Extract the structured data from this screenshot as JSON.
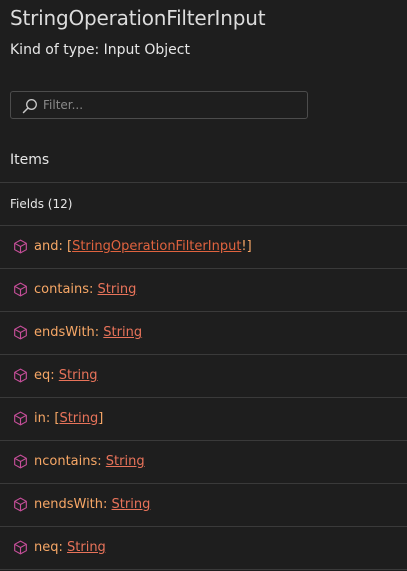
{
  "header": {
    "title": "StringOperationFilterInput",
    "kind": "Kind of type: Input Object"
  },
  "filter": {
    "placeholder": "Filter...",
    "icon": "search-icon"
  },
  "items": {
    "label": "Items"
  },
  "fields": {
    "label": "Fields (12)",
    "icon": "cube-icon",
    "rows": [
      {
        "name": "and",
        "prefix": ": [",
        "type": "StringOperationFilterInput",
        "suffix": "!]"
      },
      {
        "name": "contains",
        "prefix": ": ",
        "type": "String",
        "suffix": ""
      },
      {
        "name": "endsWith",
        "prefix": ": ",
        "type": "String",
        "suffix": ""
      },
      {
        "name": "eq",
        "prefix": ": ",
        "type": "String",
        "suffix": ""
      },
      {
        "name": "in",
        "prefix": ": [",
        "type": "String",
        "suffix": "]"
      },
      {
        "name": "ncontains",
        "prefix": ": ",
        "type": "String",
        "suffix": ""
      },
      {
        "name": "nendsWith",
        "prefix": ": ",
        "type": "String",
        "suffix": ""
      },
      {
        "name": "neq",
        "prefix": ": ",
        "type": "String",
        "suffix": ""
      }
    ]
  },
  "colors": {
    "background": "#1e1e1e",
    "field_name": "#f7a766",
    "type_link": "#e8735a",
    "icon": "#c74f9a",
    "divider": "#3a3a3a"
  }
}
